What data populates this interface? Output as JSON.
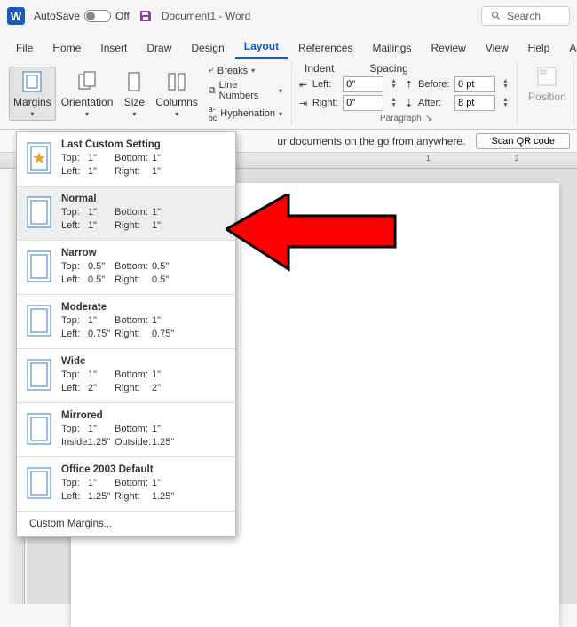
{
  "titlebar": {
    "app_letter": "W",
    "autosave_label": "AutoSave",
    "autosave_state": "Off",
    "doc_title": "Document1 - Word",
    "search_placeholder": "Search"
  },
  "tabs": [
    "File",
    "Home",
    "Insert",
    "Draw",
    "Design",
    "Layout",
    "References",
    "Mailings",
    "Review",
    "View",
    "Help",
    "Acro"
  ],
  "active_tab": "Layout",
  "ribbon": {
    "margins": "Margins",
    "orientation": "Orientation",
    "size": "Size",
    "columns": "Columns",
    "breaks": "Breaks",
    "line_numbers": "Line Numbers",
    "hyphenation": "Hyphenation",
    "indent_header": "Indent",
    "spacing_header": "Spacing",
    "left_label": "Left:",
    "right_label": "Right:",
    "before_label": "Before:",
    "after_label": "After:",
    "left_val": "0\"",
    "right_val": "0\"",
    "before_val": "0 pt",
    "after_val": "8 pt",
    "paragraph_label": "Paragraph",
    "position": "Position"
  },
  "infobar": {
    "msg": "ur documents on the go from anywhere.",
    "qr": "Scan QR code"
  },
  "ruler_marks": [
    "1",
    "2"
  ],
  "margins_menu": {
    "items": [
      {
        "name": "Last Custom Setting",
        "top": "1\"",
        "bottom": "1\"",
        "leftlbl": "Left:",
        "left": "1\"",
        "rightlbl": "Right:",
        "right": "1\"",
        "star": true
      },
      {
        "name": "Normal",
        "top": "1\"",
        "bottom": "1\"",
        "leftlbl": "Left:",
        "left": "1\"",
        "rightlbl": "Right:",
        "right": "1\"",
        "hover": true
      },
      {
        "name": "Narrow",
        "top": "0.5\"",
        "bottom": "0.5\"",
        "leftlbl": "Left:",
        "left": "0.5\"",
        "rightlbl": "Right:",
        "right": "0.5\""
      },
      {
        "name": "Moderate",
        "top": "1\"",
        "bottom": "1\"",
        "leftlbl": "Left:",
        "left": "0.75\"",
        "rightlbl": "Right:",
        "right": "0.75\""
      },
      {
        "name": "Wide",
        "top": "1\"",
        "bottom": "1\"",
        "leftlbl": "Left:",
        "left": "2\"",
        "rightlbl": "Right:",
        "right": "2\""
      },
      {
        "name": "Mirrored",
        "top": "1\"",
        "bottom": "1\"",
        "leftlbl": "Inside:",
        "left": "1.25\"",
        "rightlbl": "Outside:",
        "right": "1.25\""
      },
      {
        "name": "Office 2003 Default",
        "top": "1\"",
        "bottom": "1\"",
        "leftlbl": "Left:",
        "left": "1.25\"",
        "rightlbl": "Right:",
        "right": "1.25\""
      }
    ],
    "labels": {
      "top": "Top:",
      "bottom": "Bottom:"
    },
    "custom": "Custom Margins..."
  }
}
